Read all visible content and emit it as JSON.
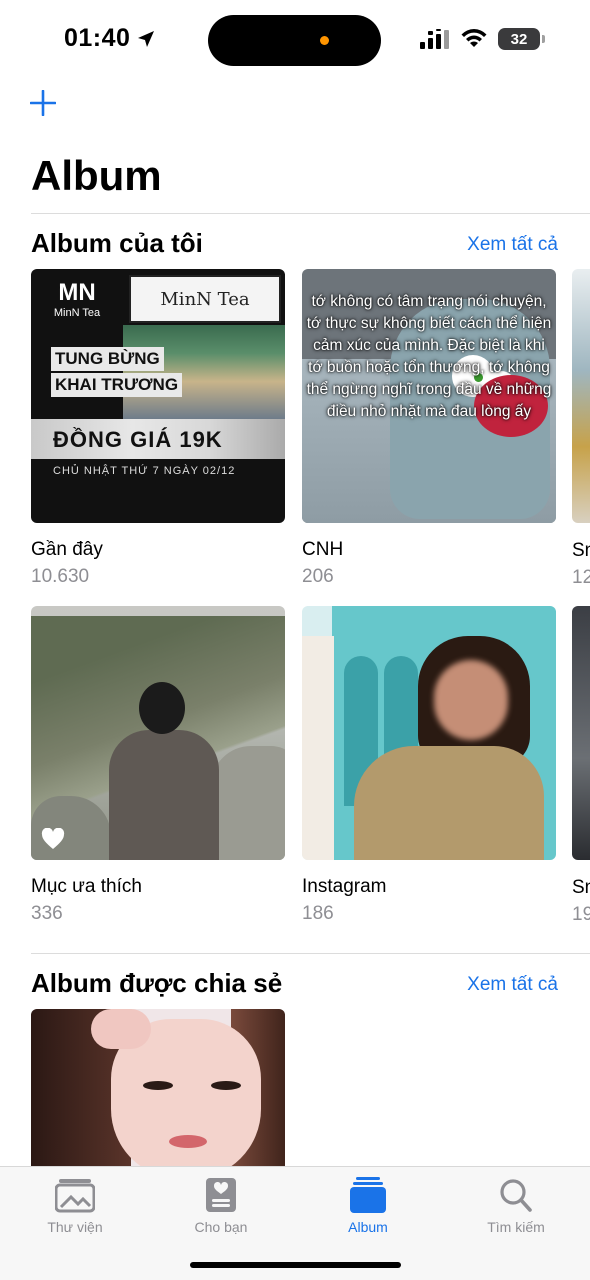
{
  "status_bar": {
    "time": "01:40",
    "battery": "32"
  },
  "header": {
    "add_icon": "plus-icon",
    "title": "Album"
  },
  "my_albums": {
    "title": "Album của tôi",
    "see_all": "Xem tất cả",
    "items": [
      {
        "name": "Gần đây",
        "count": "10.630"
      },
      {
        "name": "CNH",
        "count": "206"
      },
      {
        "name": "Mục ưa thích",
        "count": "336"
      },
      {
        "name": "Instagram",
        "count": "186"
      }
    ],
    "peek_items": [
      {
        "name": "Sn",
        "count": "12"
      },
      {
        "name": "Sn",
        "count": "19"
      }
    ]
  },
  "thumbs": {
    "recent": {
      "sign": "MinN Tea",
      "logo_mark": "MN",
      "logo_text": "MinN Tea",
      "line1": "TUNG BỪNG",
      "line2": "KHAI TRƯƠNG",
      "price": "ĐỒNG GIÁ 19K",
      "note": "CHỦ NHẬT THỨ 7 NGÀY 02/12"
    },
    "cnh": {
      "caption": "tớ không có tâm trạng nói chuyện, tớ thực sự không biết cách thể hiện cảm xúc của mình. Đặc biệt là khi tớ buồn hoặc tổn thương, tớ không thể ngừng nghĩ trong đầu về những điều nhỏ nhặt mà đau lòng ấy"
    }
  },
  "shared_albums": {
    "title": "Album được chia sẻ",
    "see_all": "Xem tất cả"
  },
  "tab_bar": {
    "tabs": [
      {
        "label": "Thư viện",
        "icon": "photo-library-icon"
      },
      {
        "label": "Cho bạn",
        "icon": "for-you-icon"
      },
      {
        "label": "Album",
        "icon": "album-icon",
        "active": true
      },
      {
        "label": "Tìm kiếm",
        "icon": "search-icon"
      }
    ]
  },
  "colors": {
    "accent": "#1a73e8",
    "secondary_text": "#8e8e93"
  }
}
